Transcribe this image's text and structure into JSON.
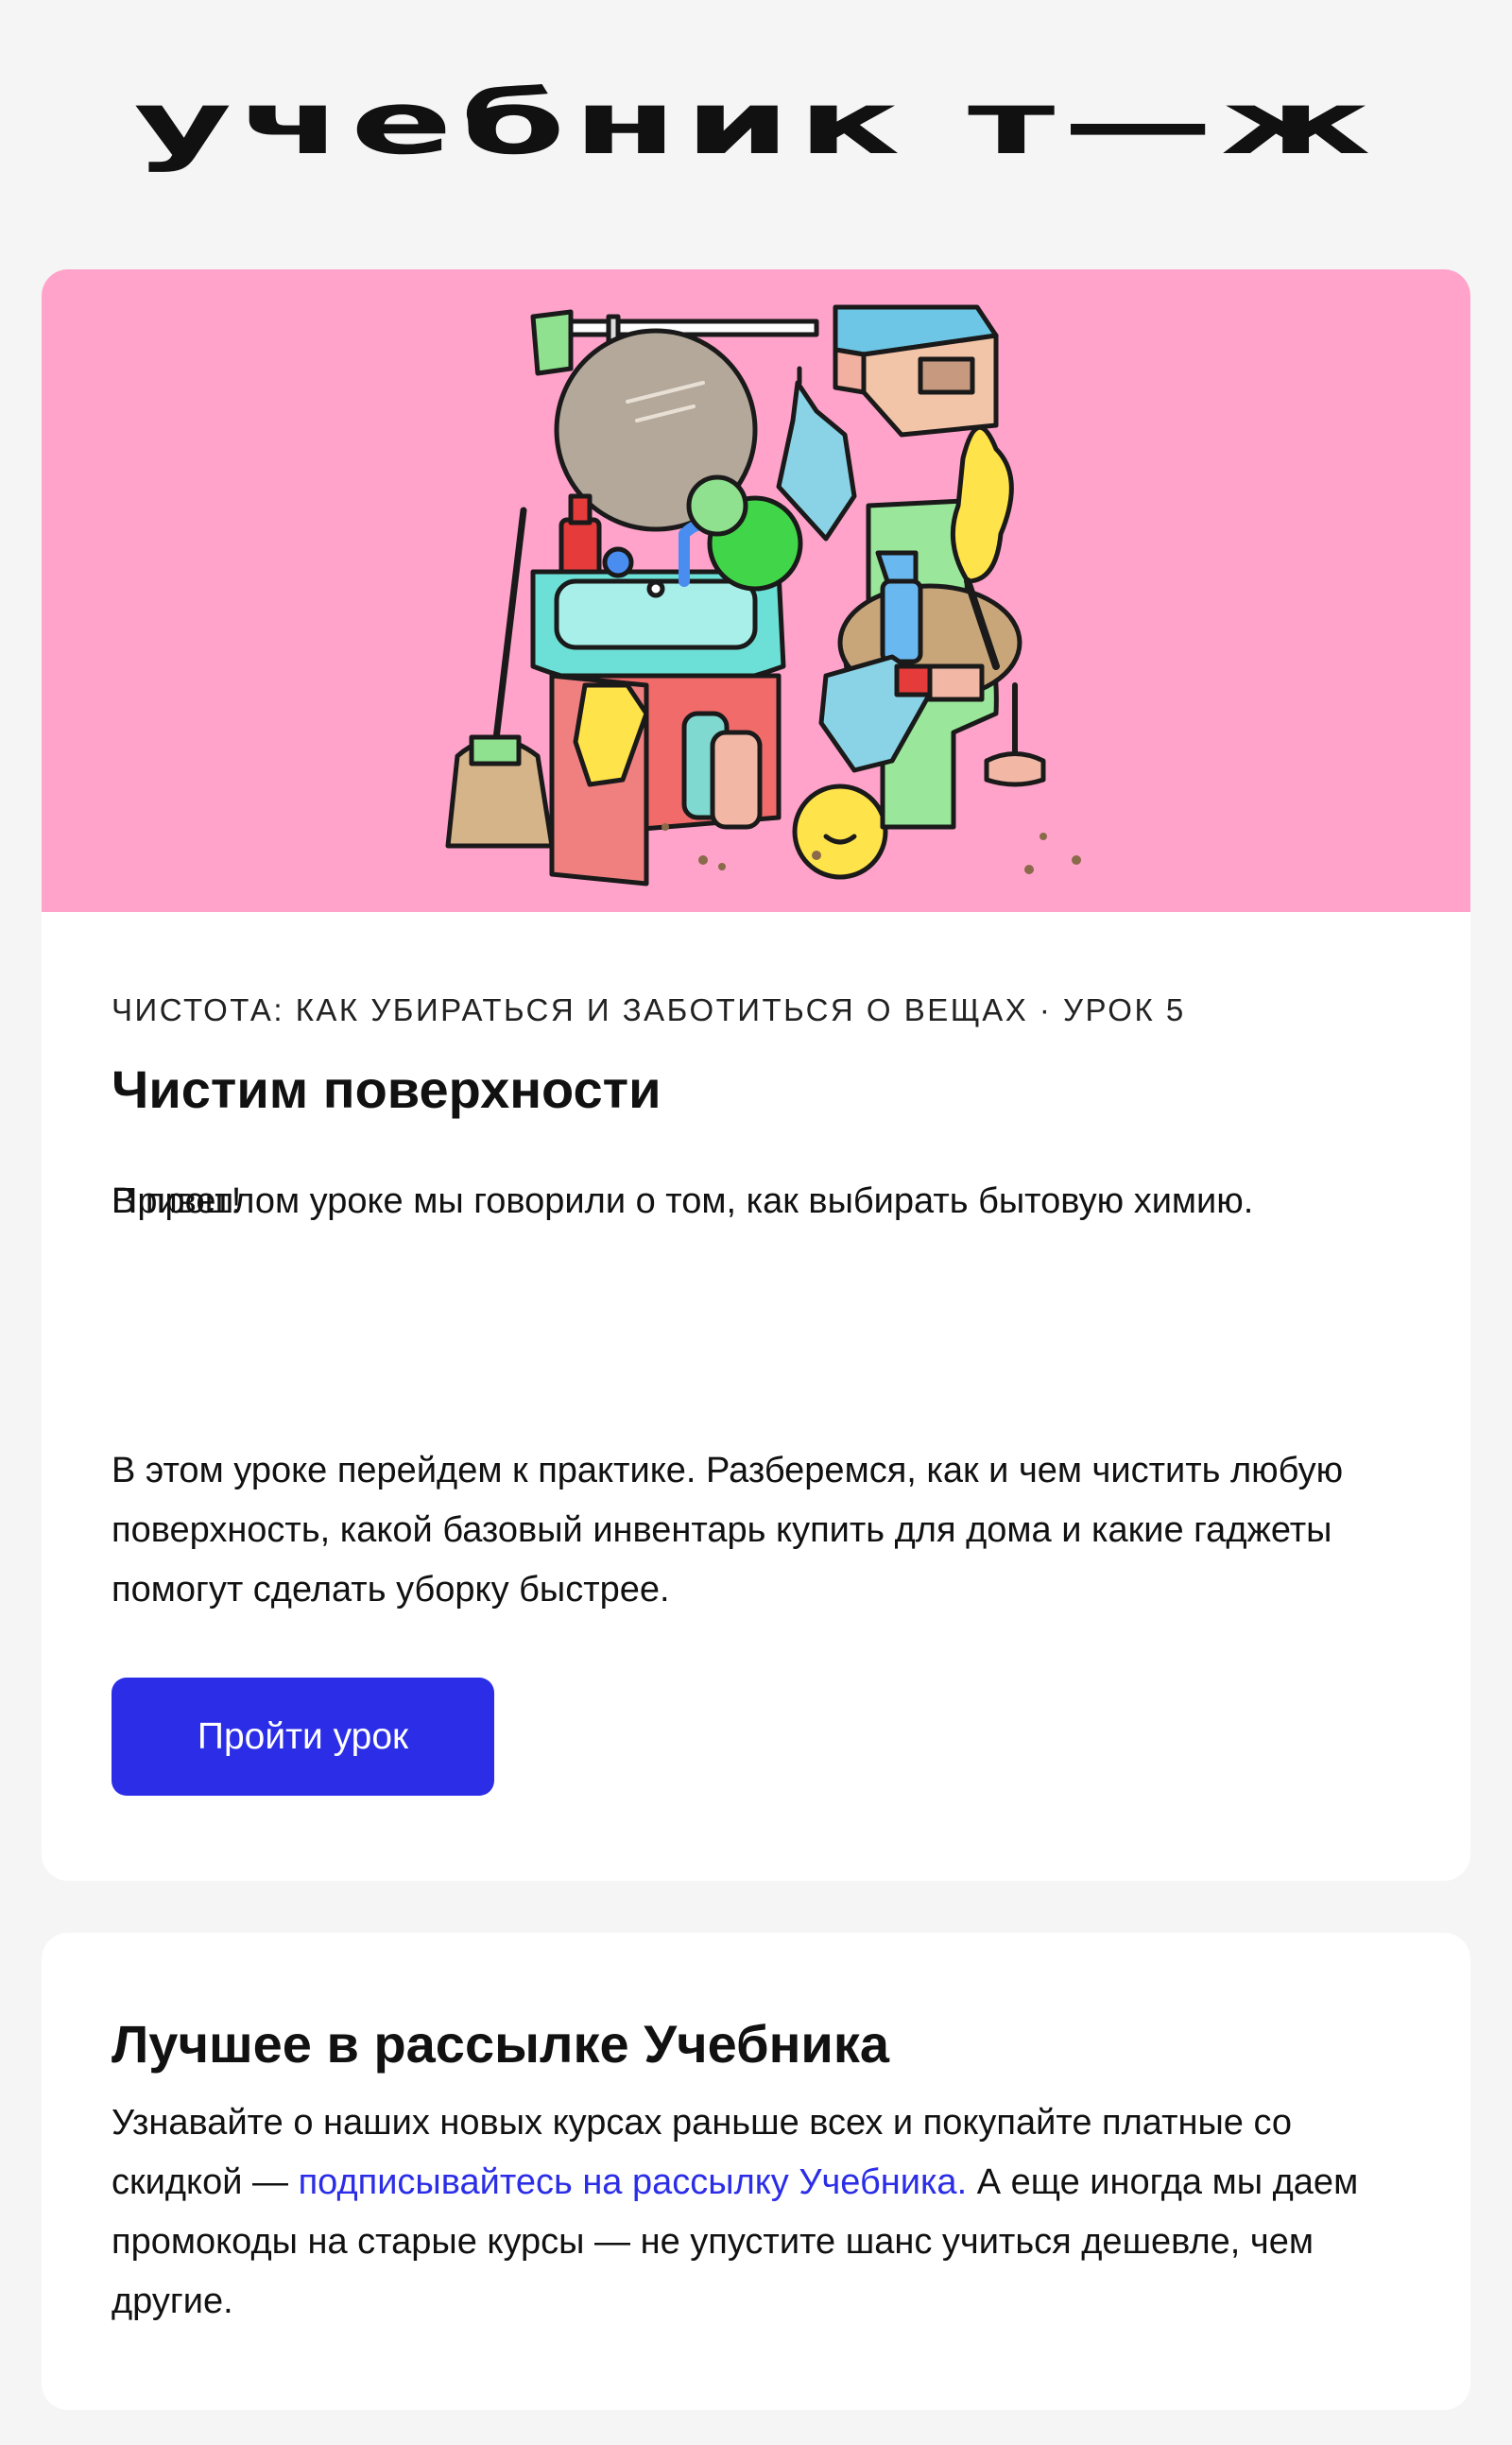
{
  "brand": {
    "logo_text": "учебник т—ж"
  },
  "lesson": {
    "eyebrow": "ЧИСТОТА: КАК УБИРАТЬСЯ И ЗАБОТИТЬСЯ О ВЕЩАХ · УРОК 5",
    "title": "Чистим поверхности",
    "greeting": "Привет!",
    "paragraph_1": "В прошлом уроке мы говорили о том, как выбирать бытовую химию.",
    "paragraph_2": "В этом уроке перейдем к практике. Разберемся, как и чем чистить любую поверхность, какой базовый инвентарь купить для дома и какие гаджеты помогут сделать уборку быстрее.",
    "cta_label": "Пройти урок",
    "hero_bg_color": "#ffa3ca"
  },
  "newsletter": {
    "title": "Лучшее в рассылке Учебника",
    "text_before_link": "Узнавайте о наших новых курсах раньше всех и покупайте платные со скидкой — ",
    "link_text": "подписывайтесь на рассылку Учебника.",
    "text_after_link": " А еще иногда мы даем промокоды на старые курсы — не упустите шанс учиться дешевле, чем другие."
  },
  "colors": {
    "accent": "#2b2ee6",
    "page_bg": "#f5f5f5",
    "card_bg": "#ffffff"
  }
}
